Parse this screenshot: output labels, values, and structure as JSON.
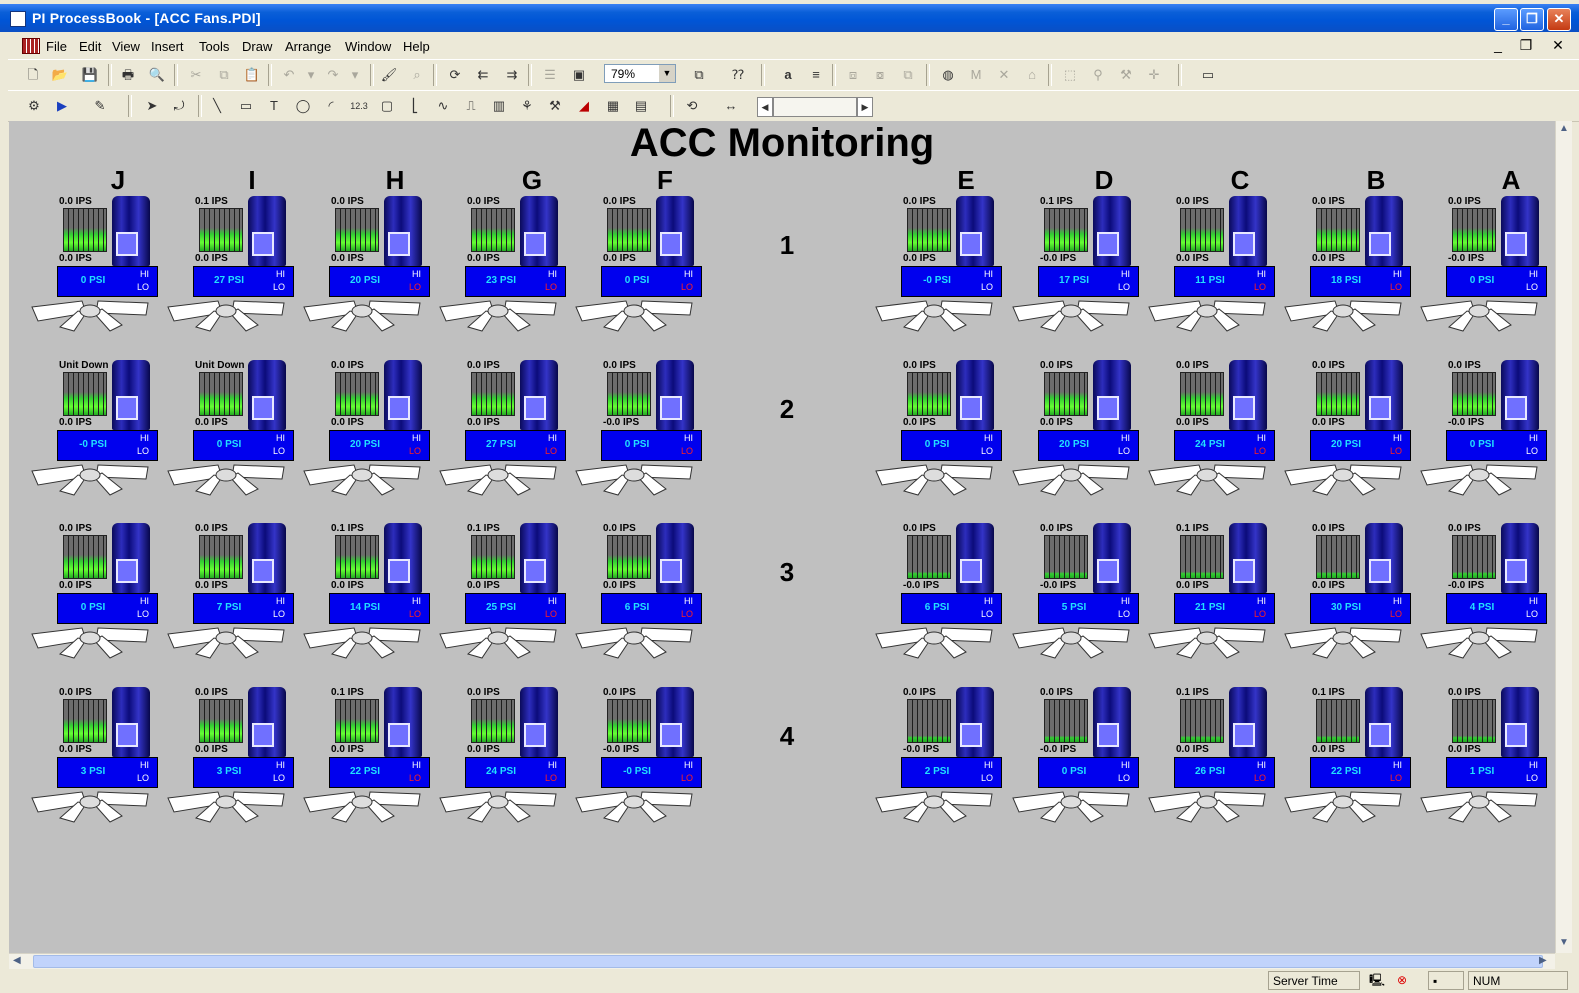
{
  "window": {
    "title": "PI ProcessBook - [ACC Fans.PDI]"
  },
  "menu": [
    "File",
    "Edit",
    "View",
    "Insert",
    "Tools",
    "Draw",
    "Arrange",
    "Window",
    "Help"
  ],
  "toolbar": {
    "zoom": "79%",
    "zoom_arrow": "▼"
  },
  "display": {
    "title": "ACC Monitoring",
    "left_columns": [
      "J",
      "I",
      "H",
      "G",
      "F"
    ],
    "right_columns": [
      "E",
      "D",
      "C",
      "B",
      "A"
    ],
    "rows": [
      "1",
      "2",
      "3",
      "4"
    ],
    "hi_label": "HI",
    "lo_label": "LO",
    "fans": [
      [
        {
          "top": "0.0 IPS",
          "bottom": "0.0 IPS",
          "psi": "0 PSI"
        },
        {
          "top": "0.1 IPS",
          "bottom": "0.0 IPS",
          "psi": "27 PSI"
        },
        {
          "top": "0.0 IPS",
          "bottom": "0.0 IPS",
          "psi": "20 PSI"
        },
        {
          "top": "0.0 IPS",
          "bottom": "0.0 IPS",
          "psi": "23 PSI"
        },
        {
          "top": "0.0 IPS",
          "bottom": "0.0 IPS",
          "psi": "0 PSI"
        },
        {
          "top": "0.0 IPS",
          "bottom": "0.0 IPS",
          "psi": "-0 PSI"
        },
        {
          "top": "0.1 IPS",
          "bottom": "-0.0 IPS",
          "psi": "17 PSI"
        },
        {
          "top": "0.0 IPS",
          "bottom": "0.0 IPS",
          "psi": "11 PSI"
        },
        {
          "top": "0.0 IPS",
          "bottom": "0.0 IPS",
          "psi": "18 PSI"
        },
        {
          "top": "0.0 IPS",
          "bottom": "-0.0 IPS",
          "psi": "0 PSI"
        }
      ],
      [
        {
          "top": "Unit Down",
          "bottom": "0.0 IPS",
          "psi": "-0 PSI"
        },
        {
          "top": "Unit Down",
          "bottom": "0.0 IPS",
          "psi": "0 PSI"
        },
        {
          "top": "0.0 IPS",
          "bottom": "0.0 IPS",
          "psi": "20 PSI"
        },
        {
          "top": "0.0 IPS",
          "bottom": "0.0 IPS",
          "psi": "27 PSI"
        },
        {
          "top": "0.0 IPS",
          "bottom": "-0.0 IPS",
          "psi": "0 PSI"
        },
        {
          "top": "0.0 IPS",
          "bottom": "0.0 IPS",
          "psi": "0 PSI"
        },
        {
          "top": "0.0 IPS",
          "bottom": "0.0 IPS",
          "psi": "20 PSI"
        },
        {
          "top": "0.0 IPS",
          "bottom": "0.0 IPS",
          "psi": "24 PSI"
        },
        {
          "top": "0.0 IPS",
          "bottom": "0.0 IPS",
          "psi": "20 PSI"
        },
        {
          "top": "0.0 IPS",
          "bottom": "-0.0 IPS",
          "psi": "0 PSI"
        }
      ],
      [
        {
          "top": "0.0 IPS",
          "bottom": "0.0 IPS",
          "psi": "0 PSI"
        },
        {
          "top": "0.0 IPS",
          "bottom": "0.0 IPS",
          "psi": "7 PSI"
        },
        {
          "top": "0.1 IPS",
          "bottom": "0.0 IPS",
          "psi": "14 PSI"
        },
        {
          "top": "0.1 IPS",
          "bottom": "0.0 IPS",
          "psi": "25 PSI"
        },
        {
          "top": "0.0 IPS",
          "bottom": "0.0 IPS",
          "psi": "6 PSI"
        },
        {
          "top": "0.0 IPS",
          "bottom": "-0.0 IPS",
          "psi": "6 PSI"
        },
        {
          "top": "0.0 IPS",
          "bottom": "-0.0 IPS",
          "psi": "5 PSI"
        },
        {
          "top": "0.1 IPS",
          "bottom": "0.0 IPS",
          "psi": "21 PSI"
        },
        {
          "top": "0.0 IPS",
          "bottom": "0.0 IPS",
          "psi": "30 PSI"
        },
        {
          "top": "0.0 IPS",
          "bottom": "-0.0 IPS",
          "psi": "4 PSI"
        }
      ],
      [
        {
          "top": "0.0 IPS",
          "bottom": "0.0 IPS",
          "psi": "3 PSI"
        },
        {
          "top": "0.0 IPS",
          "bottom": "0.0 IPS",
          "psi": "3 PSI"
        },
        {
          "top": "0.1 IPS",
          "bottom": "0.0 IPS",
          "psi": "22 PSI"
        },
        {
          "top": "0.0 IPS",
          "bottom": "0.0 IPS",
          "psi": "24 PSI"
        },
        {
          "top": "0.0 IPS",
          "bottom": "-0.0 IPS",
          "psi": "-0 PSI"
        },
        {
          "top": "0.0 IPS",
          "bottom": "-0.0 IPS",
          "psi": "2 PSI"
        },
        {
          "top": "0.0 IPS",
          "bottom": "-0.0 IPS",
          "psi": "0 PSI"
        },
        {
          "top": "0.1 IPS",
          "bottom": "0.0 IPS",
          "psi": "26 PSI"
        },
        {
          "top": "0.1 IPS",
          "bottom": "0.0 IPS",
          "psi": "22 PSI"
        },
        {
          "top": "0.0 IPS",
          "bottom": "0.0 IPS",
          "psi": "1 PSI"
        }
      ]
    ]
  },
  "status": {
    "server_time": "Server Time",
    "num": "NUM"
  }
}
